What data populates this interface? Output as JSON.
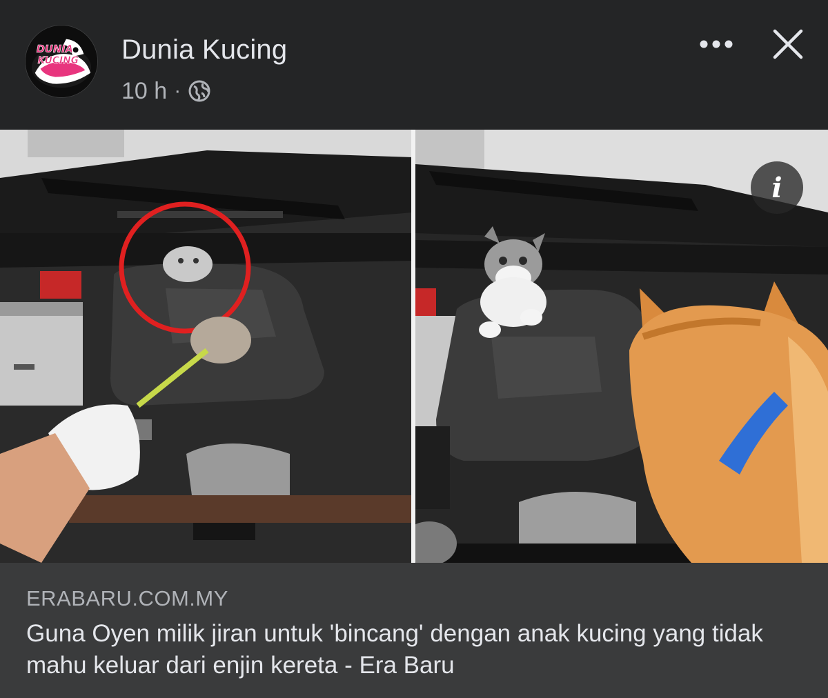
{
  "post": {
    "author": "Dunia Kucing",
    "timestamp": "10 h",
    "separator": "·",
    "audience_icon": "globe-icon",
    "avatar_logo_text": [
      "DUNIA",
      "KUCING"
    ]
  },
  "actions": {
    "more_icon": "more-dots-icon",
    "close_icon": "close-icon",
    "info_label": "i"
  },
  "media": {
    "photos": [
      {
        "subject": "hand with feather duster reaching a kitten inside car engine bay, kitten circled in red"
      },
      {
        "subject": "grey-white kitten on engine cover facing an orange cat with blue collar"
      }
    ]
  },
  "link_preview": {
    "domain": "ERABARU.COM.MY",
    "title": "Guna Oyen milik jiran untuk 'bincang' dengan anak kucing yang tidak mahu keluar dari enjin kereta - Era Baru"
  },
  "colors": {
    "background": "#242526",
    "link_preview_bg": "#3a3b3c",
    "primary_text": "#e4e6eb",
    "secondary_text": "#b0b3b8",
    "highlight_circle": "#e02020",
    "logo_pink": "#e8357e"
  }
}
